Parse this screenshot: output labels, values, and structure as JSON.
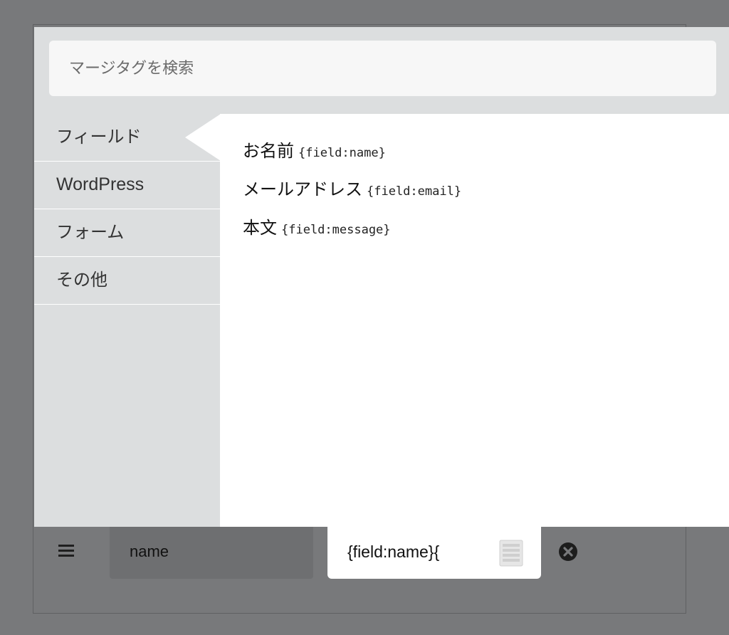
{
  "search": {
    "placeholder": "マージタグを検索"
  },
  "categories": [
    {
      "label": "フィールド",
      "active": true
    },
    {
      "label": "WordPress",
      "active": false
    },
    {
      "label": "フォーム",
      "active": false
    },
    {
      "label": "その他",
      "active": false
    }
  ],
  "tags": [
    {
      "label": "お名前",
      "code": "{field:name}"
    },
    {
      "label": "メールアドレス",
      "code": "{field:email}"
    },
    {
      "label": "本文",
      "code": "{field:message}"
    }
  ],
  "field_row": {
    "name": "name",
    "value": "{field:name}{"
  },
  "icons": {
    "menu": "hamburger-menu-icon",
    "merge_tags": "list-icon",
    "remove": "close-circle-icon"
  },
  "colors": {
    "overlay": "#78797b",
    "popup_bg": "#dcdedf",
    "content_bg": "#ffffff"
  }
}
